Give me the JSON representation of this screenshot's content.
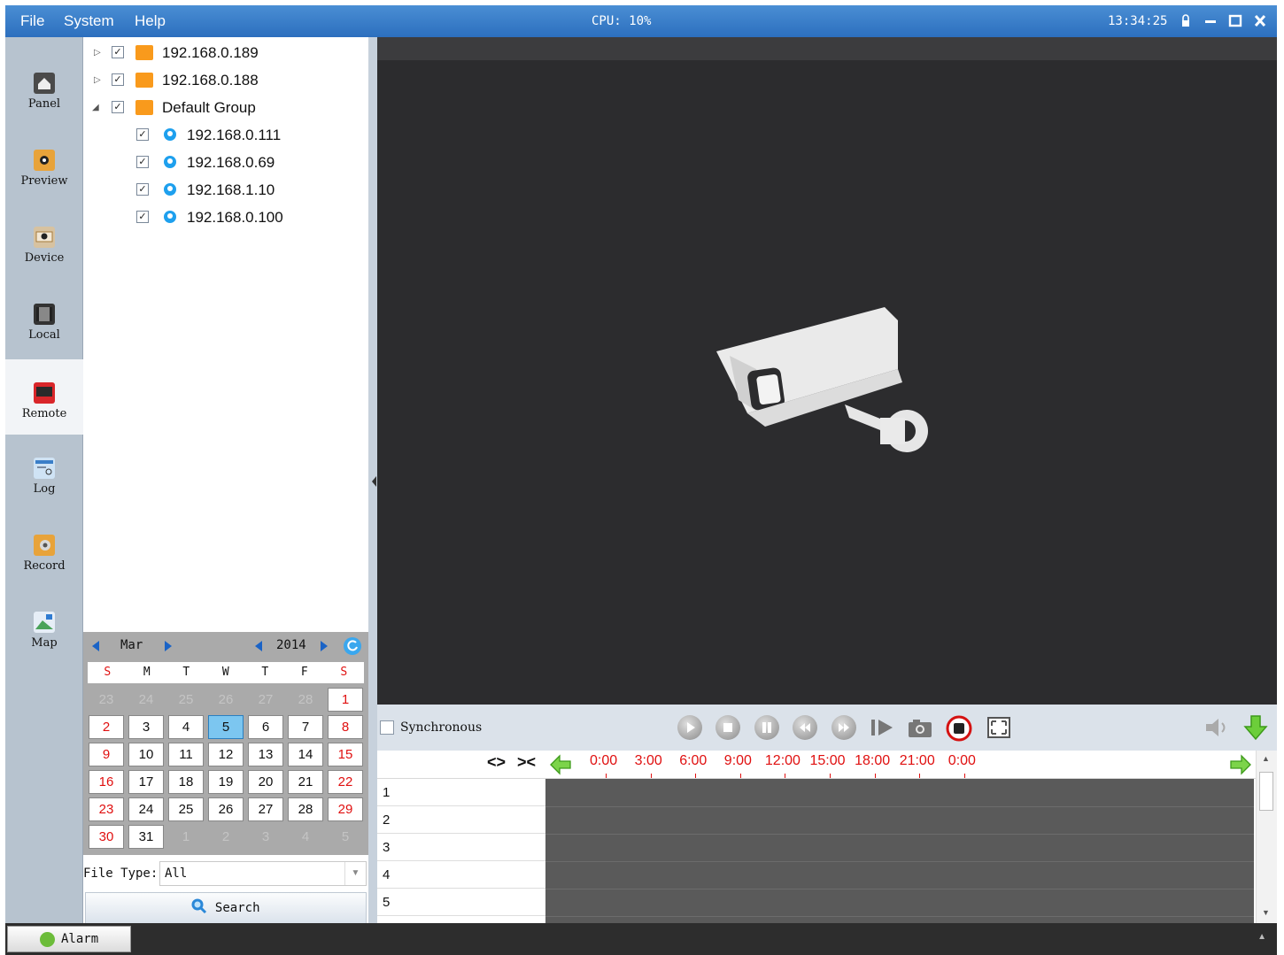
{
  "menu": {
    "file": "File",
    "system": "System",
    "help": "Help"
  },
  "cpu": "CPU: 10%",
  "clock": "13:34:25",
  "window_buttons": [
    "lock-icon",
    "minimize-icon",
    "maximize-icon",
    "close-icon"
  ],
  "nav": {
    "items": [
      {
        "label": "Panel",
        "icon": "home-icon"
      },
      {
        "label": "Preview",
        "icon": "camera-icon"
      },
      {
        "label": "Device",
        "icon": "device-icon"
      },
      {
        "label": "Local",
        "icon": "film-icon"
      },
      {
        "label": "Remote",
        "icon": "remote-icon"
      },
      {
        "label": "Log",
        "icon": "log-icon"
      },
      {
        "label": "Record",
        "icon": "record-icon"
      },
      {
        "label": "Map",
        "icon": "map-icon"
      }
    ],
    "active": "Remote"
  },
  "tree": {
    "groups": [
      {
        "label": "192.168.0.189",
        "checked": true,
        "expanded": false
      },
      {
        "label": "192.168.0.188",
        "checked": true,
        "expanded": false
      },
      {
        "label": "Default Group",
        "checked": true,
        "expanded": true
      }
    ],
    "devices": [
      {
        "label": "192.168.0.111",
        "checked": true
      },
      {
        "label": "192.168.0.69",
        "checked": true
      },
      {
        "label": "192.168.1.10",
        "checked": true
      },
      {
        "label": "192.168.0.100",
        "checked": true
      }
    ]
  },
  "calendar": {
    "month": "Mar",
    "year": "2014",
    "weekdays": [
      "S",
      "M",
      "T",
      "W",
      "T",
      "F",
      "S"
    ],
    "weeks": [
      [
        "23",
        "24",
        "25",
        "26",
        "27",
        "28",
        "1"
      ],
      [
        "2",
        "3",
        "4",
        "5",
        "6",
        "7",
        "8"
      ],
      [
        "9",
        "10",
        "11",
        "12",
        "13",
        "14",
        "15"
      ],
      [
        "16",
        "17",
        "18",
        "19",
        "20",
        "21",
        "22"
      ],
      [
        "23",
        "24",
        "25",
        "26",
        "27",
        "28",
        "29"
      ],
      [
        "30",
        "31",
        "1",
        "2",
        "3",
        "4",
        "5"
      ]
    ],
    "selected": "5"
  },
  "file_type": {
    "label": "File Type:",
    "value": "All"
  },
  "search_label": "Search",
  "controls": {
    "synchronous_label": "Synchronous",
    "synchronous_checked": false
  },
  "timeline": {
    "hours": [
      "0:00",
      "3:00",
      "6:00",
      "9:00",
      "12:00",
      "15:00",
      "18:00",
      "21:00",
      "0:00"
    ],
    "zoom_in": "<>",
    "zoom_out": "><",
    "channels": [
      "1",
      "2",
      "3",
      "4",
      "5"
    ]
  },
  "statusbar": {
    "alarm_label": "Alarm"
  }
}
